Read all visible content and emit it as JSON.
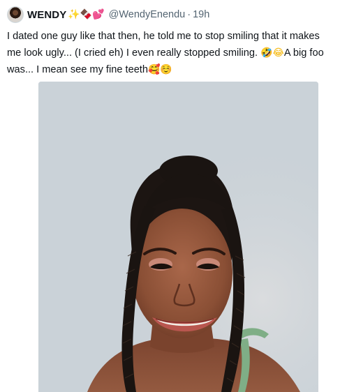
{
  "tweet": {
    "display_name": "WENDY",
    "name_emojis": [
      "✨",
      "🍫",
      "💕"
    ],
    "handle": "@WendyEnendu",
    "separator": "·",
    "time": "19h",
    "text_lines": [
      "I dated one guy like that then, he told me to stop smiling that it makes",
      "me look ugly... (I cried eh) I even really stopped smiling. ",
      "was... I mean see my fine teeth"
    ],
    "line2_emojis": "🤣😂",
    "line2_tail": "A big foo",
    "line3_emojis": "🥰☺️"
  },
  "media": {
    "kind": "photo",
    "icon": "selfie-photo",
    "background_color": "#cbd3d9",
    "accent_colors": {
      "hair": "#1a1411",
      "skin": "#8a4f35",
      "lips": "#b9564f",
      "strap": "#7fae86"
    }
  }
}
